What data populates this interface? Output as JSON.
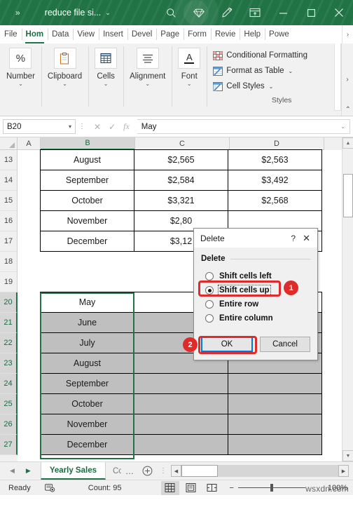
{
  "titlebar": {
    "chevron": "»",
    "document_name": "reduce file si...",
    "caret": "⌄",
    "icons": [
      "search-icon",
      "diamond-icon",
      "pen-icon",
      "ribbon-display-icon",
      "minimize-icon",
      "maximize-icon",
      "close-icon"
    ]
  },
  "ribbon_tabs": [
    {
      "label": "File",
      "active": false
    },
    {
      "label": "Hom",
      "active": true
    },
    {
      "label": "Data",
      "active": false
    },
    {
      "label": "View",
      "active": false
    },
    {
      "label": "Insert",
      "active": false
    },
    {
      "label": "Devel",
      "active": false
    },
    {
      "label": "Page",
      "active": false
    },
    {
      "label": "Form",
      "active": false
    },
    {
      "label": "Revie",
      "active": false
    },
    {
      "label": "Help",
      "active": false
    },
    {
      "label": "Powe",
      "active": false
    }
  ],
  "ribbon": {
    "groups": [
      {
        "label": "Number",
        "icon": "percent-icon",
        "glyph": "%"
      },
      {
        "label": "Clipboard",
        "icon": "clipboard-icon",
        "glyph": ""
      },
      {
        "label": "Cells",
        "icon": "cells-table-icon",
        "glyph": ""
      },
      {
        "label": "Alignment",
        "icon": "alignment-icon",
        "glyph": ""
      },
      {
        "label": "Font",
        "icon": "font-a-icon",
        "glyph": "A"
      }
    ],
    "caret": "⌄",
    "styles": {
      "caption": "Styles",
      "items": [
        {
          "label": "Conditional Formatting",
          "icon": "conditional-formatting-icon",
          "has_caret": false
        },
        {
          "label": "Format as Table",
          "icon": "format-as-table-icon",
          "has_caret": true
        },
        {
          "label": "Cell Styles",
          "icon": "cell-styles-icon",
          "has_caret": true
        }
      ],
      "caret": "⌄"
    },
    "overflow_arrow": "›",
    "collapse_arrow": "⌃"
  },
  "formula_bar": {
    "name_box_value": "B20",
    "name_box_caret": "▾",
    "cancel_icon": "✕",
    "enter_icon": "✓",
    "function_icon": "fx",
    "formula_value": "May",
    "expand_caret": "⌄",
    "dots": "⋮"
  },
  "grid": {
    "columns": [
      "A",
      "B",
      "C",
      "D"
    ],
    "selected_column": "B",
    "rows": [
      {
        "num": "13",
        "selected": false,
        "b": "August",
        "c": "$2,565",
        "d": "$2,563",
        "bordered": true,
        "shaded": false
      },
      {
        "num": "14",
        "selected": false,
        "b": "September",
        "c": "$2,584",
        "d": "$3,492",
        "bordered": true,
        "shaded": false
      },
      {
        "num": "15",
        "selected": false,
        "b": "October",
        "c": "$3,321",
        "d": "$2,568",
        "bordered": true,
        "shaded": false
      },
      {
        "num": "16",
        "selected": false,
        "b": "November",
        "c": "$2,80",
        "d": "",
        "bordered": true,
        "shaded": false
      },
      {
        "num": "17",
        "selected": false,
        "b": "December",
        "c": "$3,12",
        "d": "",
        "bordered": true,
        "shaded": false
      },
      {
        "num": "18",
        "selected": false,
        "b": "",
        "c": "",
        "d": "",
        "bordered": false,
        "shaded": false
      },
      {
        "num": "19",
        "selected": false,
        "b": "",
        "c": "",
        "d": "",
        "bordered": false,
        "shaded": false
      },
      {
        "num": "20",
        "selected": true,
        "b": "May",
        "c": "",
        "d": "",
        "bordered": true,
        "shaded": false
      },
      {
        "num": "21",
        "selected": true,
        "b": "June",
        "c": "",
        "d": "",
        "bordered": true,
        "shaded": true
      },
      {
        "num": "22",
        "selected": true,
        "b": "July",
        "c": "",
        "d": "",
        "bordered": true,
        "shaded": true
      },
      {
        "num": "23",
        "selected": true,
        "b": "August",
        "c": "",
        "d": "",
        "bordered": true,
        "shaded": true
      },
      {
        "num": "24",
        "selected": true,
        "b": "September",
        "c": "",
        "d": "",
        "bordered": true,
        "shaded": true
      },
      {
        "num": "25",
        "selected": true,
        "b": "October",
        "c": "",
        "d": "",
        "bordered": true,
        "shaded": true
      },
      {
        "num": "26",
        "selected": true,
        "b": "November",
        "c": "",
        "d": "",
        "bordered": true,
        "shaded": true
      },
      {
        "num": "27",
        "selected": true,
        "b": "December",
        "c": "",
        "d": "",
        "bordered": true,
        "shaded": true
      }
    ],
    "scroll_up_arrow": "▲",
    "scroll_down_arrow": "▼"
  },
  "dialog": {
    "title": "Delete",
    "help_icon": "?",
    "close_icon": "✕",
    "group_label": "Delete",
    "options": [
      {
        "label": "Shift cells left",
        "selected": false,
        "focused": false
      },
      {
        "label": "Shift cells up",
        "selected": true,
        "focused": true
      },
      {
        "label": "Entire row",
        "selected": false,
        "focused": false
      },
      {
        "label": "Entire column",
        "selected": false,
        "focused": false
      }
    ],
    "ok_label": "OK",
    "cancel_label": "Cancel"
  },
  "annotations": [
    {
      "badge": "1"
    },
    {
      "badge": "2"
    }
  ],
  "sheet_bar": {
    "prev_arrow": "◀",
    "next_arrow": "▶",
    "active_tab": "Yearly Sales",
    "hidden_tab": "Co",
    "overflow_dots": "…",
    "add_sheet_icon": "add-sheet-icon",
    "split_icon": "⋮",
    "hs_left": "◀",
    "hs_right": "▶"
  },
  "status_bar": {
    "mode": "Ready",
    "macro_icon": "record-macro-icon",
    "count_label": "Count: 95",
    "views": [
      "normal-view-icon",
      "page-layout-icon",
      "page-break-icon"
    ],
    "zoom_out": "−",
    "zoom_in": "+",
    "zoom_level": "100%",
    "watermark": "wsxdn.com"
  },
  "colors": {
    "excel_green": "#217346",
    "selection_green": "#217346",
    "annotation_red": "#e02b2b",
    "shade_gray": "#bfbfbf",
    "focus_blue": "#0078d7"
  }
}
